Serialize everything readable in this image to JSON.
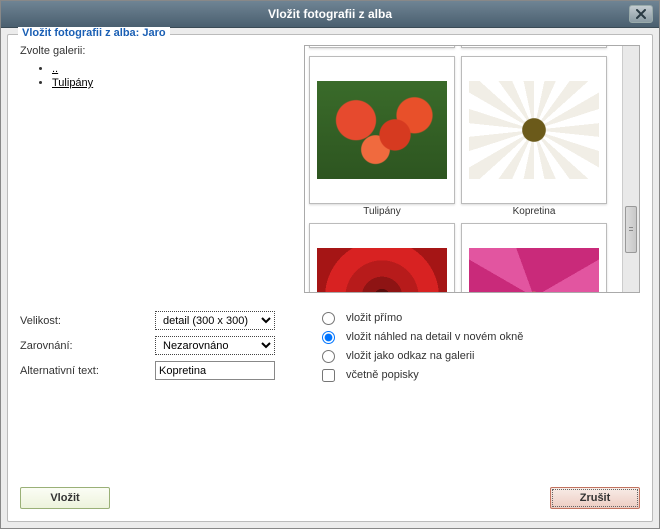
{
  "title": "Vložit fotografii z alba",
  "legend": "Vložit fotografii z alba: Jaro",
  "choose_gallery_label": "Zvolte galerii:",
  "tree": {
    "parent": "..",
    "item1": "Tulipány"
  },
  "thumbs": [
    {
      "caption": ""
    },
    {
      "caption": ""
    },
    {
      "caption": "Tulipány"
    },
    {
      "caption": "Kopretina"
    },
    {
      "caption": ""
    },
    {
      "caption": ""
    }
  ],
  "form": {
    "size_label": "Velikost:",
    "size_value": "detail (300 x 300)",
    "align_label": "Zarovnání:",
    "align_value": "Nezarovnáno",
    "alt_label": "Alternativní text:",
    "alt_value": "Kopretina"
  },
  "options": {
    "o1": "vložit přímo",
    "o2": "vložit náhled na detail v novém okně",
    "o3": "vložit jako odkaz na galerii",
    "o4": "včetně popisky"
  },
  "buttons": {
    "insert": "Vložit",
    "cancel": "Zrušit"
  }
}
